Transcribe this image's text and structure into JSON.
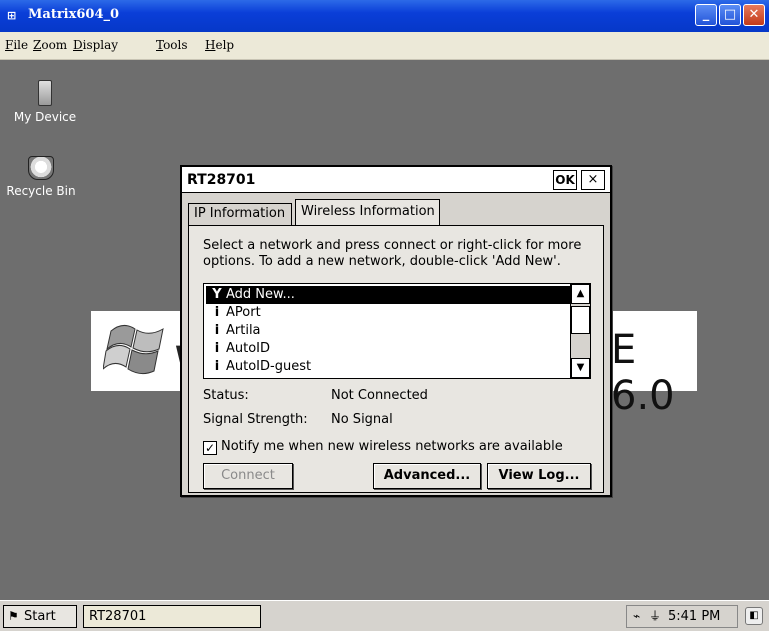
{
  "window": {
    "title": "Matrix604_0",
    "icon": "app-icon"
  },
  "menu": {
    "items": [
      "File",
      "Zoom",
      "Display",
      "Tools",
      "Help"
    ]
  },
  "desktop": {
    "icons": [
      {
        "label": "My Device",
        "icon": "my-device-icon"
      },
      {
        "label": "Recycle Bin",
        "icon": "recycle-bin-icon"
      }
    ],
    "banner_text": "E 6.0",
    "banner_letter": "W"
  },
  "dialog": {
    "title": "RT28701",
    "ok_label": "OK",
    "close_label": "×",
    "tabs": [
      {
        "label": "IP Information",
        "active": false
      },
      {
        "label": "Wireless Information",
        "active": true
      }
    ],
    "instructions": "Select a network and press connect or right-click for more options.  To add a new network, double-click 'Add New'.",
    "networks": [
      {
        "name": "Add New...",
        "icon": "antenna-icon",
        "selected": true
      },
      {
        "name": "APort",
        "icon": "network-icon",
        "selected": false
      },
      {
        "name": "Artila",
        "icon": "network-icon",
        "selected": false
      },
      {
        "name": "AutoID",
        "icon": "network-icon",
        "selected": false
      },
      {
        "name": "AutoID-guest",
        "icon": "network-icon",
        "selected": false
      }
    ],
    "status_label": "Status:",
    "status_value": "Not Connected",
    "signal_label": "Signal Strength:",
    "signal_value": "No Signal",
    "notify_label": "Notify me when new wireless networks are available",
    "notify_checked": true,
    "buttons": {
      "connect": "Connect",
      "advanced": "Advanced...",
      "view_log": "View Log..."
    }
  },
  "taskbar": {
    "start_label": "Start",
    "task_item": "RT28701",
    "clock": "5:41 PM"
  },
  "colors": {
    "titlebar": "#0a3ed8",
    "desktop": "#6e6e6e",
    "dialog": "#d6d3ce"
  }
}
